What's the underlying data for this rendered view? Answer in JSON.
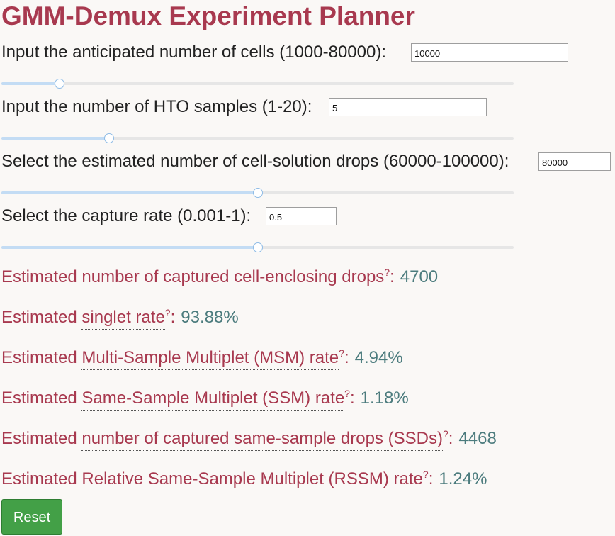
{
  "page": {
    "title": "GMM-Demux Experiment Planner"
  },
  "inputs": [
    {
      "label": "Input the anticipated number of cells (1000-80000):",
      "value": "10000",
      "slider_fraction": 0.114
    },
    {
      "label": "Input the number of HTO samples (1-20):",
      "value": "5",
      "slider_fraction": 0.21
    },
    {
      "label": "Select the estimated number of cell-solution drops (60000-100000):",
      "value": "80000",
      "slider_fraction": 0.5
    },
    {
      "label": "Select the capture rate (0.001-1):",
      "value": "0.5",
      "slider_fraction": 0.5
    }
  ],
  "results": [
    {
      "prefix": "Estimated ",
      "term": "number of captured cell-enclosing drops",
      "help": "?",
      "suffix": ":",
      "value": "4700"
    },
    {
      "prefix": "Estimated ",
      "term": "singlet rate",
      "help": "?",
      "suffix": ":",
      "value": "93.88%"
    },
    {
      "prefix": "Estimated ",
      "term": "Multi-Sample Multiplet (MSM) rate",
      "help": "?",
      "suffix": ":",
      "value": "4.94%"
    },
    {
      "prefix": "Estimated ",
      "term": "Same-Sample Multiplet (SSM) rate",
      "help": "?",
      "suffix": ":",
      "value": "1.18%"
    },
    {
      "prefix": "Estimated ",
      "term": "number of captured same-sample drops (SSDs)",
      "help": "?",
      "suffix": ":",
      "value": "4468"
    },
    {
      "prefix": "Estimated ",
      "term": "Relative Same-Sample Multiplet (RSSM) rate",
      "help": "?",
      "suffix": ":",
      "value": "1.24%"
    }
  ],
  "buttons": {
    "reset_label": "Reset"
  },
  "colors": {
    "title": "#a8394f",
    "value": "#4b7b7d",
    "reset_button": "#43a047",
    "slider_fill": "#c3dcf4"
  }
}
